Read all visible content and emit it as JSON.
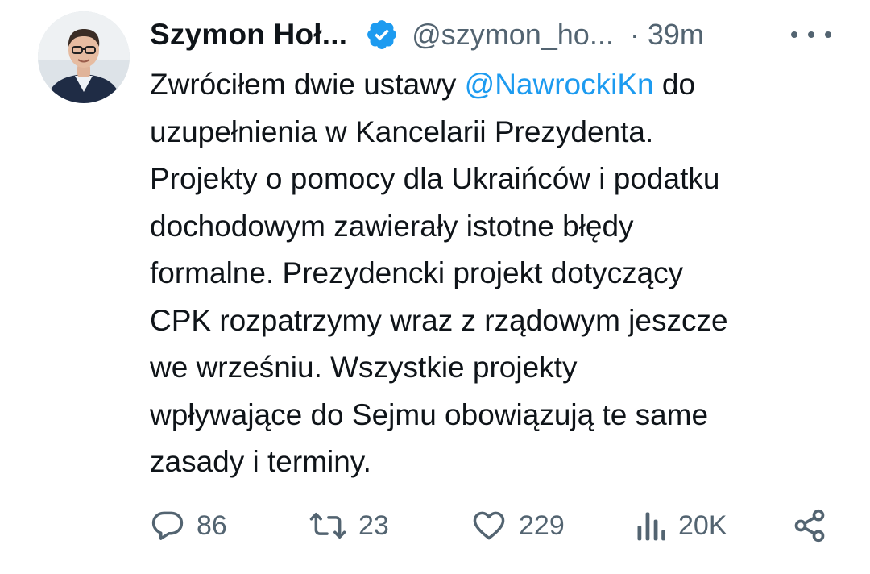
{
  "author": {
    "display_name": "Szymon Hoł...",
    "handle": "@szymon_ho...",
    "separator": "·",
    "time": "39m"
  },
  "tweet": {
    "mention": "@NawrockiKn",
    "line1_before": "Zwróciłem dwie ustawy ",
    "line1_after": " do",
    "lines": [
      "uzupełnienia w Kancelarii Prezydenta.",
      "Projekty o pomocy dla Ukraińców i podatku",
      "dochodowym zawierały istotne błędy",
      "formalne. Prezydencki projekt dotyczący",
      "CPK rozpatrzymy wraz z rządowym jeszcze",
      "we wrześniu. Wszystkie projekty",
      "wpływające do Sejmu obowiązują te same",
      "zasady i terminy."
    ]
  },
  "actions": {
    "replies": "86",
    "reposts": "23",
    "likes": "229",
    "views": "20K"
  },
  "icons": {
    "verified": "verified-badge-icon",
    "more": "more-dots-icon",
    "reply": "reply-icon",
    "repost": "repost-icon",
    "like": "heart-icon",
    "views": "views-chart-icon",
    "share": "share-icon"
  },
  "colors": {
    "text": "#0f1419",
    "secondary": "#536471",
    "accent": "#1d9bf0"
  }
}
